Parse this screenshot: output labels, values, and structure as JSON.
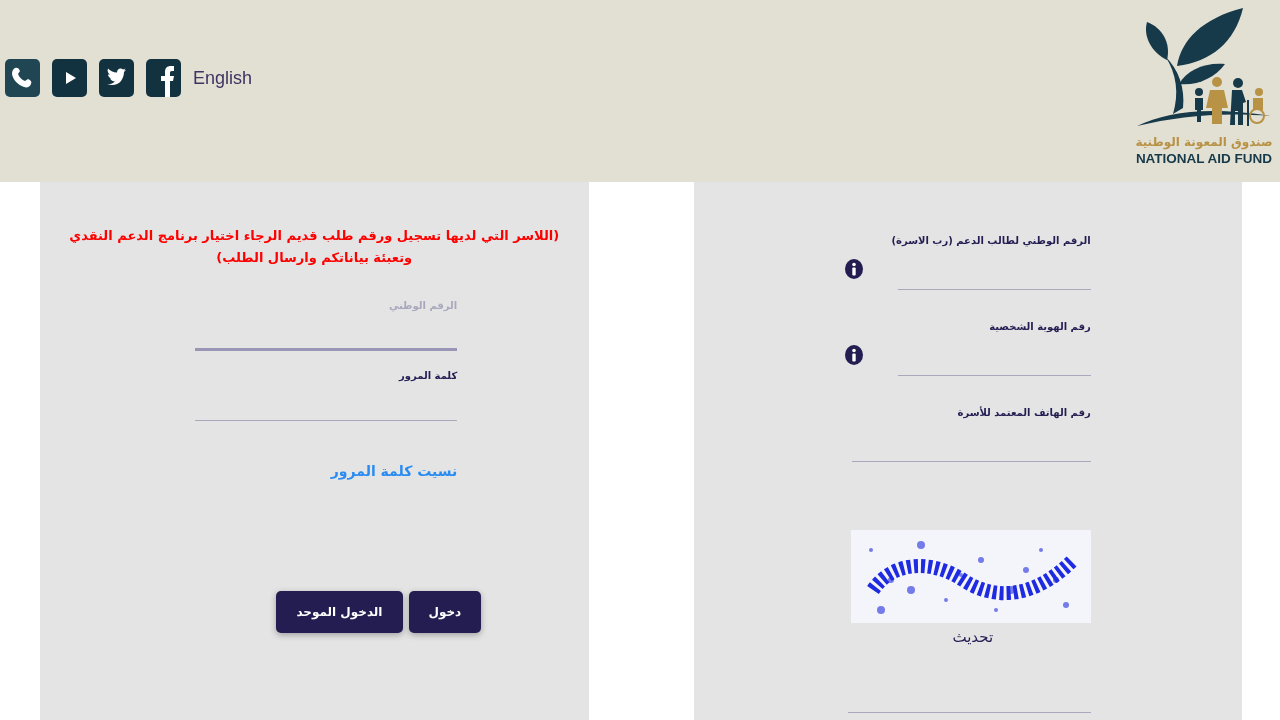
{
  "header": {
    "social_links": [
      {
        "kind": "phone"
      },
      {
        "kind": "youtube"
      },
      {
        "kind": "twitter"
      },
      {
        "kind": "facebook"
      }
    ],
    "language_link": "English",
    "logo": {
      "arabic_name": "صندوق المعونة الوطنية",
      "english_name": "NATIONAL AID FUND"
    }
  },
  "login": {
    "notice": "(اللاسر التي لديها تسجيل ورقم طلب قديم الرجاء اختيار برنامج الدعم النقدي وتعبئة بياناتكم وارسال الطلب)",
    "fields": [
      {
        "label": "الرقم الوطني",
        "focused": true
      },
      {
        "label": "كلمة المرور",
        "focused": false
      }
    ],
    "forgot_link": "نسيت كلمة المرور",
    "buttons": [
      "دخول",
      "الدخول الموحد"
    ]
  },
  "register": {
    "fields": [
      {
        "label": "الرقم الوطني لطالب الدعم (رب الاسرة)",
        "info": true
      },
      {
        "label": "رقم الهوية الشخصية",
        "info": true
      },
      {
        "label": "رقم الهاتف المعتمد للأسرة",
        "info": false
      }
    ],
    "captcha": {
      "kind": "picture",
      "refresh_link": "تحديث"
    }
  }
}
